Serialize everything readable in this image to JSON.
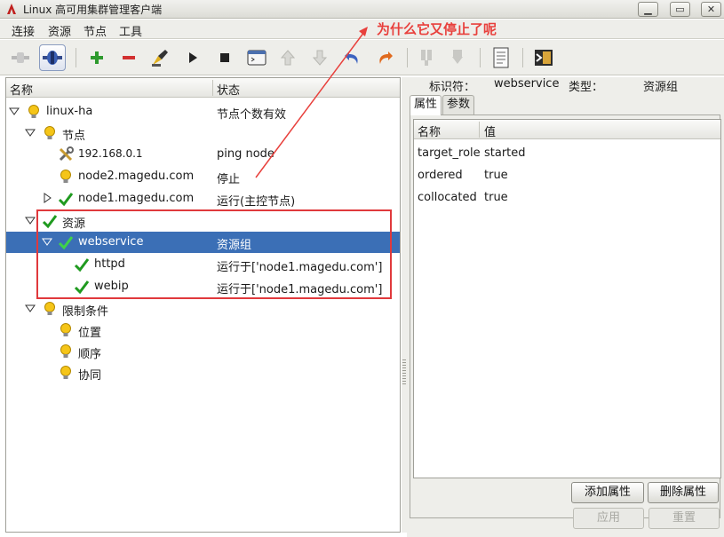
{
  "window": {
    "title": "Linux 高可用集群管理客户端",
    "buttons": {
      "minimize": "▁",
      "maximize": "▭",
      "close": "✕"
    }
  },
  "menu": [
    "连接",
    "资源",
    "节点",
    "工具"
  ],
  "toolbar": {
    "icons": [
      "disconnect-icon",
      "connect-icon",
      "add-icon",
      "remove-icon",
      "cleanup-icon",
      "start-icon",
      "stop-icon",
      "console-icon",
      "move-up-icon",
      "move-down-icon",
      "undo-icon",
      "redo-icon",
      "standby-icon",
      "active-icon",
      "log-icon",
      "exit-icon"
    ]
  },
  "tree": {
    "columns": {
      "name": "名称",
      "status": "状态"
    },
    "rows": [
      {
        "name": "linux-ha",
        "status": "节点个数有效",
        "icon": "bulb-icon"
      },
      {
        "name": "节点",
        "status": "",
        "icon": "bulb-icon"
      },
      {
        "name": "192.168.0.1",
        "status": "ping node",
        "icon": "tools-icon"
      },
      {
        "name": "node2.magedu.com",
        "status": "停止",
        "icon": "bulb-icon"
      },
      {
        "name": "node1.magedu.com",
        "status": "运行(主控节点)",
        "icon": "check-icon"
      },
      {
        "name": "资源",
        "status": "",
        "icon": "check-icon"
      },
      {
        "name": "webservice",
        "status": "资源组",
        "icon": "check-icon"
      },
      {
        "name": "httpd",
        "status": "运行于['node1.magedu.com']",
        "icon": "check-icon"
      },
      {
        "name": "webip",
        "status": "运行于['node1.magedu.com']",
        "icon": "check-icon"
      },
      {
        "name": "限制条件",
        "status": "",
        "icon": "bulb-icon"
      },
      {
        "name": "位置",
        "status": "",
        "icon": "bulb-icon"
      },
      {
        "name": "顺序",
        "status": "",
        "icon": "bulb-icon"
      },
      {
        "name": "协同",
        "status": "",
        "icon": "bulb-icon"
      }
    ]
  },
  "details": {
    "id_label": "标识符：",
    "id_value": "webservice",
    "type_label": "类型：",
    "type_value": "资源组",
    "tabs": [
      "属性",
      "参数"
    ],
    "columns": {
      "name": "名称",
      "value": "值"
    },
    "attributes": [
      {
        "name": "target_role",
        "value": "started"
      },
      {
        "name": "ordered",
        "value": "true"
      },
      {
        "name": "collocated",
        "value": "true"
      }
    ],
    "add_button": "添加属性",
    "delete_button": "删除属性",
    "apply_button": "应用",
    "reset_button": "重置"
  },
  "annotation": {
    "text": "为什么它又停止了呢",
    "color": "#e8403c"
  },
  "colors": {
    "selection": "#3b6fb6",
    "check": "#1f9a1f",
    "bulb": "#f5c518"
  }
}
